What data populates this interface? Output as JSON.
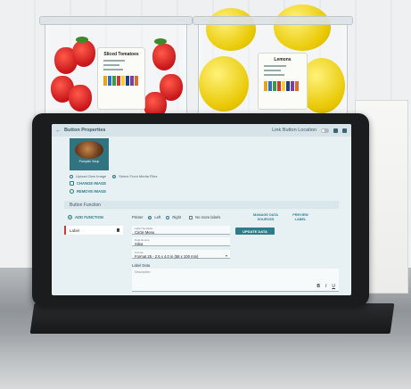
{
  "containers": {
    "left_label_title": "Sliced Tomatoes",
    "right_label_title": "Lemons",
    "bar_colors": [
      "#e6a61c",
      "#2f72c4",
      "#3a9a45",
      "#d8352e",
      "#f4d03f",
      "#1f3f8a",
      "#7b3fa0",
      "#e06a2a"
    ]
  },
  "app": {
    "title": "Button Properties",
    "header_toggle_label": "Link Button Location"
  },
  "thumbnail": {
    "caption": "Pumpkin Soup"
  },
  "image_source": {
    "option_upload": "Upload Own Image",
    "option_media": "Select From Media Files",
    "change_image": "CHANGE IMAGE",
    "remove_image": "REMOVE IMAGE"
  },
  "function_section": {
    "title": "Button Function",
    "add_function": "ADD FUNCTION",
    "items": [
      "Label"
    ]
  },
  "form": {
    "printer_label": "Printer",
    "align_left": "Left",
    "align_right": "Right",
    "no_more_labels": "No more labels",
    "manage_data_sources": "MANAGE DATA SOURCES",
    "preview_label": "PREVIEW LABEL",
    "label_template_caption": "Label Template",
    "label_template_value": "Circle Menu",
    "data_source_caption": "Data Source",
    "data_source_value": "Silea",
    "update_data": "UPDATE DATA",
    "format_caption": "Format",
    "format_value": "Format 25 - 2.5 x 4.0 in (58 x 100 mm)",
    "label_data_title": "Label Data",
    "label_data_placeholder": "Description",
    "fmt_bold": "B",
    "fmt_italic": "I",
    "fmt_underline": "U"
  }
}
